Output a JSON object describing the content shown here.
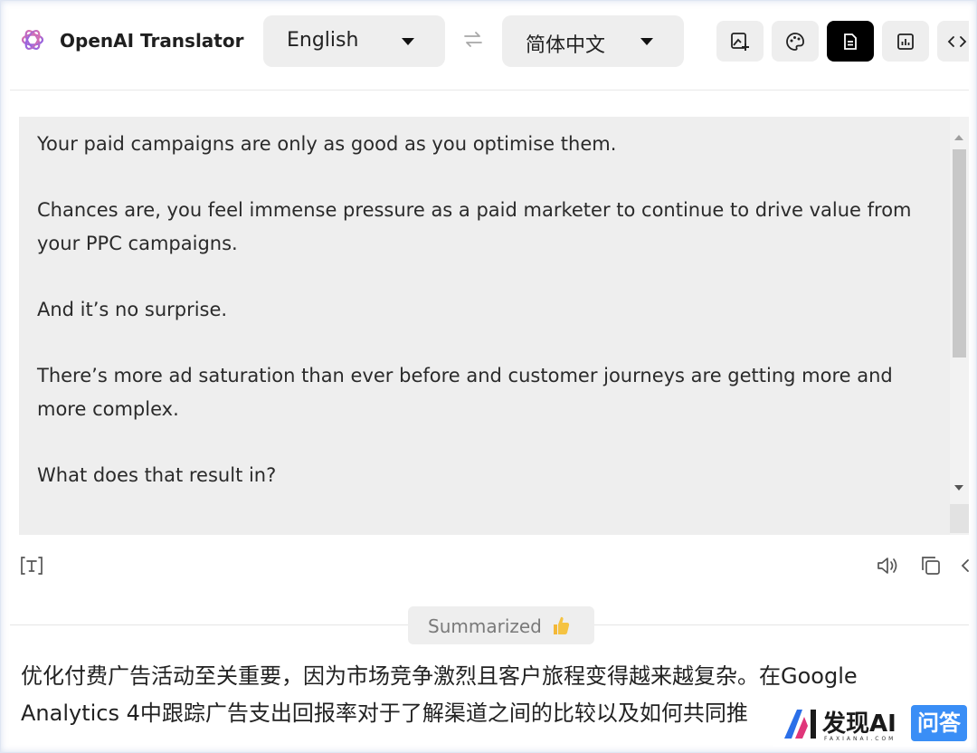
{
  "header": {
    "brand": "OpenAI Translator",
    "source_language": "English",
    "target_language": "简体中文",
    "swap_icon": "swap-arrows-icon",
    "tools": [
      {
        "name": "image-translate-icon",
        "active": false
      },
      {
        "name": "palette-icon",
        "active": false
      },
      {
        "name": "document-icon",
        "active": true
      },
      {
        "name": "stats-icon",
        "active": false
      },
      {
        "name": "code-icon",
        "active": false
      }
    ]
  },
  "source": {
    "paragraphs": [
      "Your paid campaigns are only as good as you optimise them.",
      "Chances are, you feel immense pressure as a paid marketer to continue to drive value from your PPC campaigns.",
      "And it’s no surprise.",
      "There’s more ad saturation than ever before and customer journeys are getting more and more complex.",
      "What does that result in?"
    ]
  },
  "actions": {
    "left": [
      "text-format-icon"
    ],
    "right": [
      "speaker-icon",
      "copy-icon",
      "collapse-icon"
    ]
  },
  "result": {
    "badge": "Summarized",
    "badge_icon": "thumbs-up-icon",
    "text": "优化付费广告活动至关重要，因为市场竞争激烈且客户旅程变得越来越复杂。在Google Analytics 4中跟踪广告支出回报率对于了解渠道之间的比较以及如何共同推"
  },
  "watermark": {
    "title": "发现AI",
    "sub": "FAXIANAI.COM",
    "badge": "问答"
  },
  "colors": {
    "panel_bg": "#eeeeee",
    "active_tool": "#000000",
    "accent_blue": "#3a8ef6"
  }
}
